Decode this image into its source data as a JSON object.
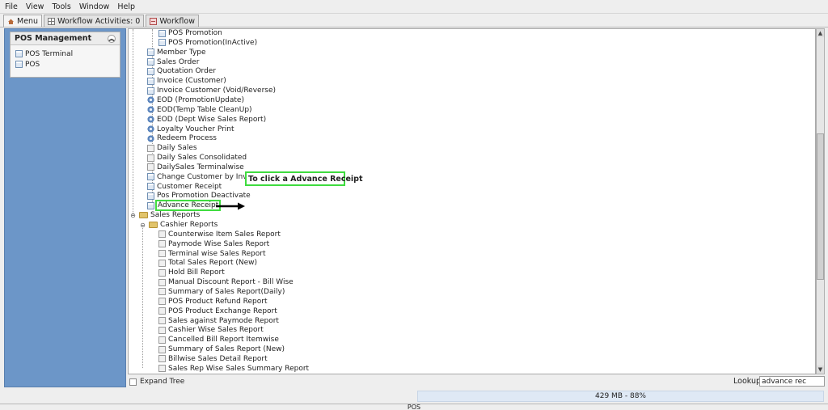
{
  "menubar": {
    "items": [
      "File",
      "View",
      "Tools",
      "Window",
      "Help"
    ]
  },
  "tabs": [
    {
      "label": "Menu",
      "icon": "home-icon"
    },
    {
      "label": "Workflow Activities: 0",
      "icon": "grid-icon"
    },
    {
      "label": "Workflow",
      "icon": "workflow-icon"
    }
  ],
  "left_panel": {
    "title": "POS Management",
    "items": [
      "POS Terminal",
      "POS"
    ]
  },
  "tree": {
    "items": [
      {
        "label": "POS Promotion",
        "icon": "doc"
      },
      {
        "label": "POS Promotion(InActive)",
        "icon": "doc"
      },
      {
        "label": "Member Type",
        "icon": "doc"
      },
      {
        "label": "Sales Order",
        "icon": "doc"
      },
      {
        "label": "Quotation Order",
        "icon": "doc"
      },
      {
        "label": "Invoice (Customer)",
        "icon": "doc"
      },
      {
        "label": "Invoice Customer (Void/Reverse)",
        "icon": "doc"
      },
      {
        "label": "EOD (PromotionUpdate)",
        "icon": "gear"
      },
      {
        "label": "EOD(Temp Table CleanUp)",
        "icon": "gear"
      },
      {
        "label": "EOD (Dept Wise Sales Report)",
        "icon": "gear"
      },
      {
        "label": "Loyalty Voucher Print",
        "icon": "gear"
      },
      {
        "label": "Redeem Process",
        "icon": "gear"
      },
      {
        "label": "Daily Sales",
        "icon": "page"
      },
      {
        "label": "Daily Sales Consolidated",
        "icon": "page"
      },
      {
        "label": "DailySales Terminalwise",
        "icon": "page"
      },
      {
        "label": "Change Customer by Invoice",
        "icon": "doc"
      },
      {
        "label": "Customer Receipt",
        "icon": "doc"
      },
      {
        "label": "Pos Promotion Deactivate",
        "icon": "doc"
      },
      {
        "label": "Advance Receipt",
        "icon": "doc"
      },
      {
        "label": "Sales Reports",
        "icon": "folder"
      },
      {
        "label": "Cashier Reports",
        "icon": "folder"
      },
      {
        "label": "Counterwise Item Sales Report",
        "icon": "page"
      },
      {
        "label": "Paymode Wise Sales Report",
        "icon": "page"
      },
      {
        "label": "Terminal wise Sales Report",
        "icon": "page"
      },
      {
        "label": "Total Sales Report (New)",
        "icon": "page"
      },
      {
        "label": "Hold Bill Report",
        "icon": "page"
      },
      {
        "label": "Manual Discount Report - Bill Wise",
        "icon": "page"
      },
      {
        "label": "Summary of Sales Report(Daily)",
        "icon": "page"
      },
      {
        "label": "POS Product Refund Report",
        "icon": "page"
      },
      {
        "label": "POS Product Exchange Report",
        "icon": "page"
      },
      {
        "label": "Sales against Paymode Report",
        "icon": "page"
      },
      {
        "label": "Cashier Wise Sales Report",
        "icon": "page"
      },
      {
        "label": "Cancelled Bill Report Itemwise",
        "icon": "page"
      },
      {
        "label": "Summary of Sales Report (New)",
        "icon": "page"
      },
      {
        "label": "Billwise Sales Detail Report",
        "icon": "page"
      },
      {
        "label": "Sales Rep Wise Sales Summary Report",
        "icon": "page"
      }
    ]
  },
  "annotation": {
    "text": "To click  a Advance Receipt"
  },
  "bottom": {
    "expand_tree_label": "Expand Tree",
    "lookup_label": "Lookup",
    "lookup_value": "advance rec"
  },
  "memory": {
    "text": "429 MB - 88%"
  },
  "status": {
    "text": "POS"
  },
  "colors": {
    "highlight": "#3fdc3f",
    "left_panel": "#6c96c8"
  }
}
